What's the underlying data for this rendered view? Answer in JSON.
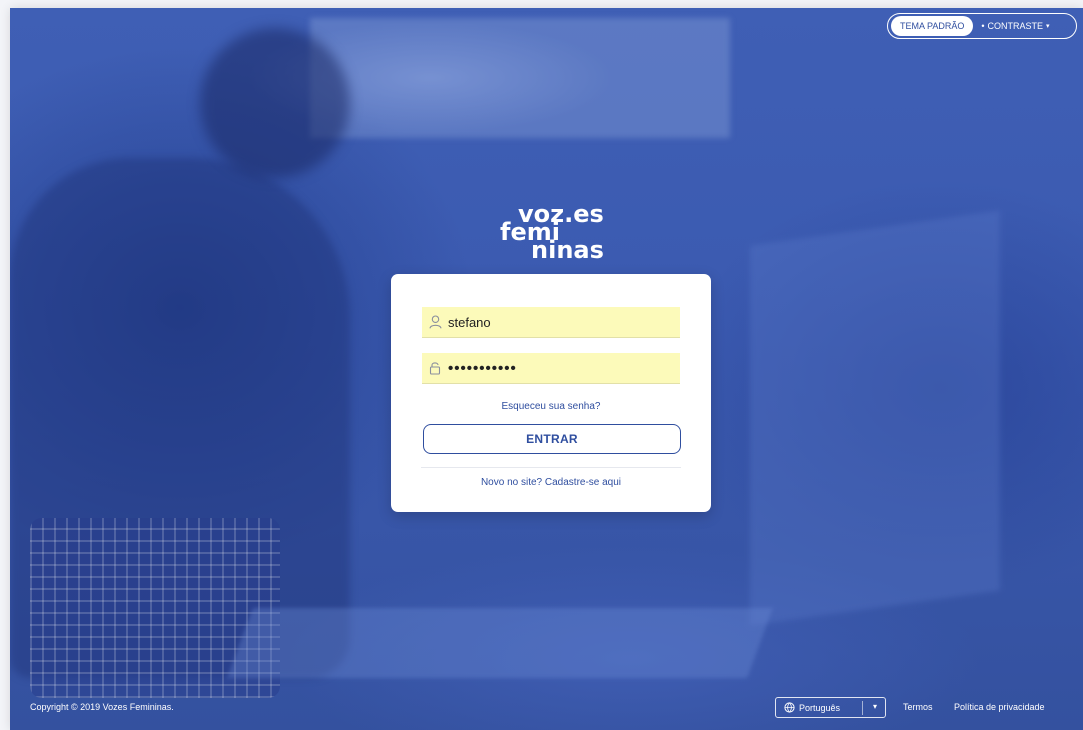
{
  "theme": {
    "default_label": "TEMA PADRÃO",
    "contrast_label": "CONTRASTE",
    "contrast_dot": "•",
    "contrast_caret": "▾"
  },
  "logo": {
    "line1": "voz.es",
    "line2": "femi",
    "line3": "ninas"
  },
  "login": {
    "username_value": "stefano",
    "password_value": "•••••••••••",
    "forgot_label": "Esqueceu sua senha?",
    "submit_label": "ENTRAR",
    "register_label": "Novo no site? Cadastre-se aqui"
  },
  "footer": {
    "copyright": "Copyright © 2019 Vozes Femininas.",
    "language": "Português",
    "language_caret": "▾",
    "terms_label": "Termos",
    "privacy_label": "Política de privacidade"
  },
  "icons": {
    "user": "user-icon",
    "lock": "lock-icon",
    "globe": "globe-icon"
  },
  "colors": {
    "brand_blue": "#2f4e9f",
    "background_blue": "#3b5ab0",
    "autofill_yellow": "#fcfaba",
    "white": "#ffffff"
  }
}
